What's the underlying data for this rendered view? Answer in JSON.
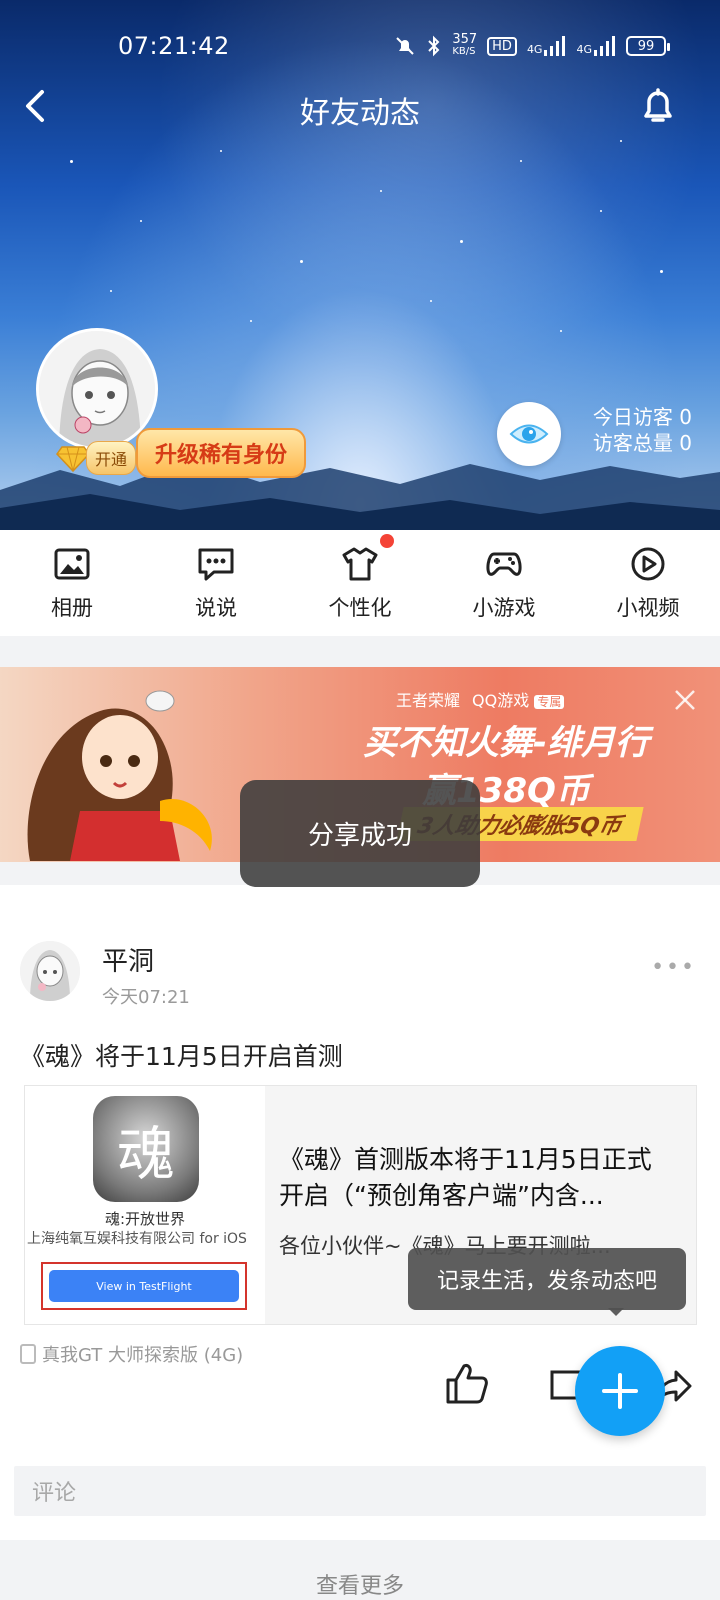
{
  "status_bar": {
    "time": "07:21:42",
    "net_speed_value": "357",
    "net_speed_unit": "KB/S",
    "hd_label": "HD",
    "network_1": "4G",
    "network_2": "4G",
    "battery": "99"
  },
  "nav": {
    "title": "好友动态",
    "back_icon": "chevron-left-icon",
    "bell_icon": "bell-icon"
  },
  "profile": {
    "vip_open_label": "开通",
    "upgrade_label": "升级稀有身份",
    "visitors_today_label": "今日访客",
    "visitors_today_value": "0",
    "visitors_total_label": "访客总量",
    "visitors_total_value": "0"
  },
  "quick_menu": [
    {
      "label": "相册",
      "icon": "image-icon"
    },
    {
      "label": "说说",
      "icon": "chat-icon"
    },
    {
      "label": "个性化",
      "icon": "shirt-icon",
      "badge": true
    },
    {
      "label": "小游戏",
      "icon": "gamepad-icon"
    },
    {
      "label": "小视频",
      "icon": "play-icon"
    }
  ],
  "banner": {
    "logo_1": "王者荣耀",
    "logo_2": "QQ游戏",
    "logo_2_tag": "专属",
    "title": "买不知火舞-绯月行",
    "prize": "赢138Q币",
    "sub": "3人助力必膨胀5Q币"
  },
  "toast": "分享成功",
  "post": {
    "user": "平洞",
    "time": "今天07:21",
    "text": "《魂》将于11月5日开启首测",
    "card": {
      "app_glyph": "魂",
      "app_name": "魂:开放世界",
      "company": "上海纯氧互娱科技有限公司 for iOS",
      "testflight_label": "View in TestFlight",
      "title": "《魂》首测版本将于11月5日正式开启（“预创角客户端”内含...",
      "desc": "各位小伙伴~《魂》马上要开测啦..."
    },
    "device": "真我GT 大师探索版 (4G)"
  },
  "tooltip": "记录生活，发条动态吧",
  "comment_placeholder": "评论",
  "see_more": "查看更多",
  "colors": {
    "fab": "#12a0f6",
    "badge_red": "#f44336",
    "banner_accent": "#ee7b62"
  }
}
